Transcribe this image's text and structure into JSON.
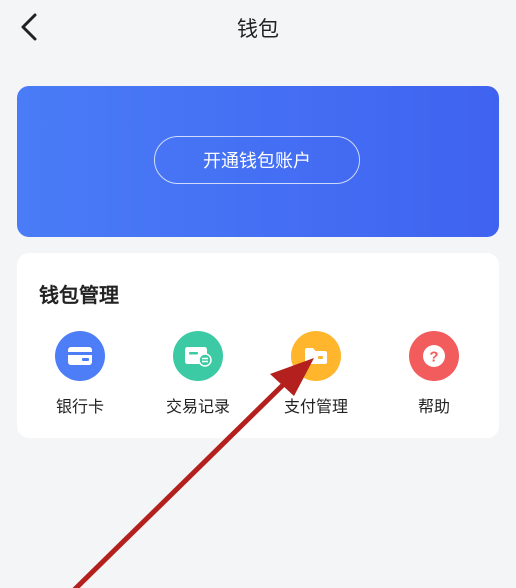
{
  "header": {
    "title": "钱包",
    "back_icon": "chevron-left-icon"
  },
  "banner": {
    "button_label": "开通钱包账户",
    "color": "#4570f5"
  },
  "management": {
    "title": "钱包管理",
    "items": [
      {
        "label": "银行卡",
        "icon": "bank-card-icon",
        "color": "#4d7df7"
      },
      {
        "label": "交易记录",
        "icon": "transaction-record-icon",
        "color": "#3ccaa4"
      },
      {
        "label": "支付管理",
        "icon": "folder-icon",
        "color": "#ffb52c"
      },
      {
        "label": "帮助",
        "icon": "question-icon",
        "color": "#f35c5c"
      }
    ]
  },
  "annotation": {
    "arrow_color": "#b3201d"
  }
}
